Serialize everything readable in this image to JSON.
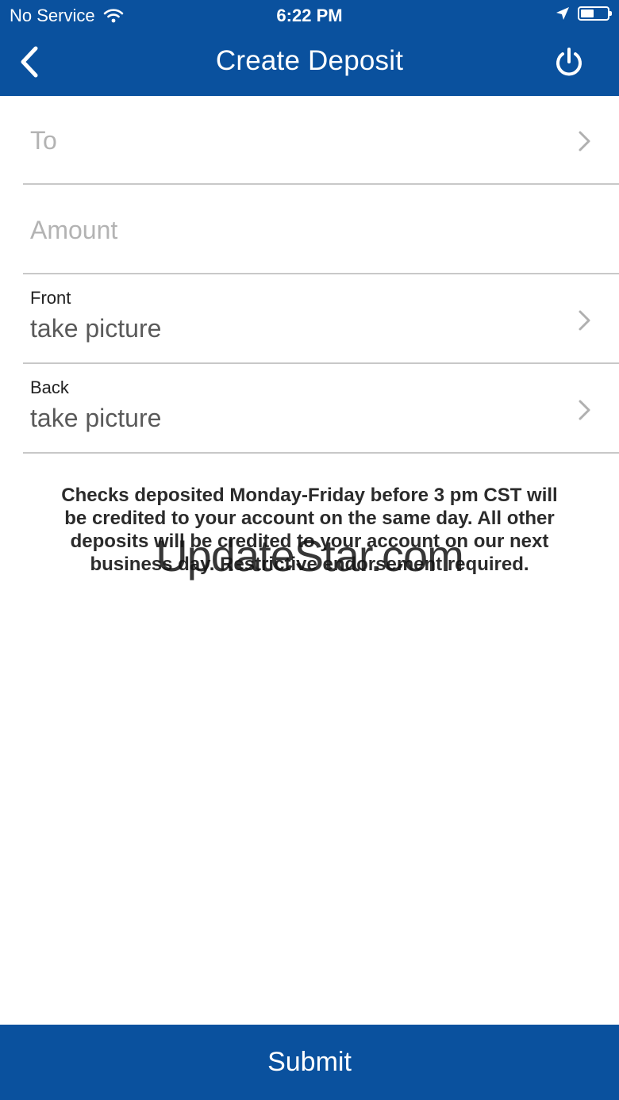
{
  "status_bar": {
    "carrier": "No Service",
    "time": "6:22 PM",
    "icons": [
      "wifi-icon",
      "location-arrow-icon",
      "battery-icon"
    ]
  },
  "nav": {
    "title": "Create Deposit",
    "back_icon": "chevron-left-icon",
    "logout_icon": "power-icon"
  },
  "form": {
    "to": {
      "placeholder": "To"
    },
    "amount": {
      "placeholder": "Amount"
    },
    "front": {
      "label": "Front",
      "value": "take picture"
    },
    "back": {
      "label": "Back",
      "value": "take picture"
    }
  },
  "disclaimer": {
    "text": "Checks deposited Monday-Friday before 3 pm CST will be credited to your account on the same day. All other deposits will be credited to your account on our next business day. Restrictive endorsement required."
  },
  "watermark": "UpdateStar.com",
  "submit_label": "Submit",
  "colors": {
    "brand_blue": "#0a519e",
    "divider": "#c8c8c8",
    "placeholder": "#b3b3b3"
  }
}
